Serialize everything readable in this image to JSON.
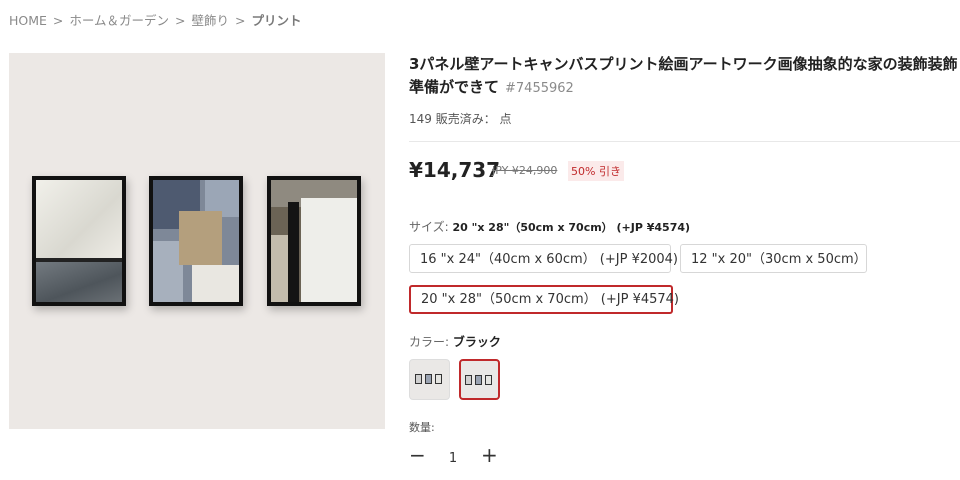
{
  "breadcrumb": {
    "items": [
      "HOME",
      "ホーム＆ガーデン",
      "壁飾り"
    ],
    "current": "プリント",
    "separator": ">"
  },
  "product": {
    "title_line1": "3パネル壁アートキャンバスプリント絵画アートワーク画像抽象的な家の装飾装飾",
    "title_line2": "準備ができて",
    "sku": "#7455962",
    "sold": "149 販売済み： 点",
    "price": "¥14,737",
    "original_price": "JPY ¥24,900",
    "discount": "50% 引き"
  },
  "size": {
    "label": "サイズ:",
    "selected": "20 \"x 28\"（50cm x 70cm） (+JP ¥4574)",
    "options": [
      "16 \"x 24\"（40cm x 60cm） (+JP ¥2004)",
      "12 \"x 20\"（30cm x 50cm）",
      "20 \"x 28\"（50cm x 70cm） (+JP ¥4574)"
    ]
  },
  "color": {
    "label": "カラー:",
    "selected": "ブラック"
  },
  "quantity": {
    "label": "数量:",
    "value": "1",
    "minus": "−",
    "plus": "+"
  },
  "colors": {
    "accent": "#c0292b",
    "image_background": "#ece8e5"
  }
}
